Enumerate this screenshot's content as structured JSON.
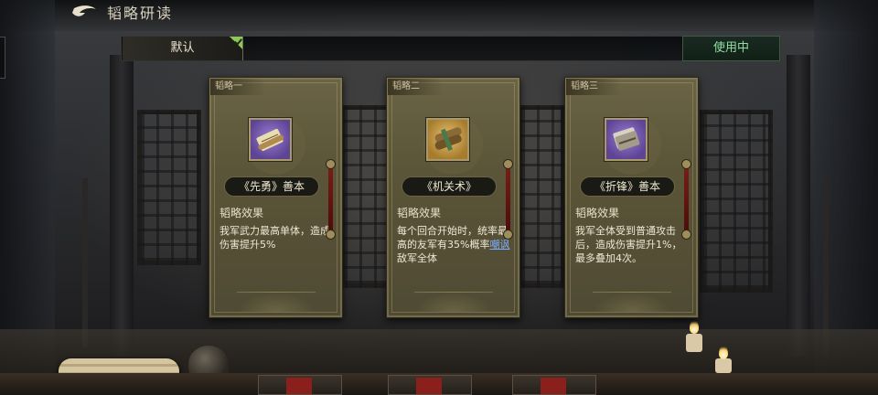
{
  "header": {
    "title": "韬略研读",
    "back_icon": "back-arrow-icon"
  },
  "preset_bar": {
    "selected_tab": "默认",
    "status_button": "使用中",
    "check_color": "#8fc65a",
    "status_color": "#8fe0a0"
  },
  "cards": [
    {
      "slot": "韬略一",
      "item_name": "《先勇》善本",
      "item_icon": "scroll-icon",
      "item_rarity_color": "#7b5fb8",
      "effect_title": "韬略效果",
      "effect_text": "我军武力最高单体，造成伤害提升5%"
    },
    {
      "slot": "韬略二",
      "item_name": "《机关术》",
      "item_icon": "scroll-bundle-icon",
      "item_rarity_color": "#c89a45",
      "effect_title": "韬略效果",
      "effect_text_before": "每个回合开始时，统率最高的友军有35%概率",
      "effect_link": "嘲讽",
      "effect_text_after": "敌军全体"
    },
    {
      "slot": "韬略三",
      "item_name": "《折锋》善本",
      "item_icon": "book-icon",
      "item_rarity_color": "#7b5fb8",
      "effect_title": "韬略效果",
      "effect_text": "我军全体受到普通攻击后，造成伤害提升1%，最多叠加4次。"
    }
  ]
}
